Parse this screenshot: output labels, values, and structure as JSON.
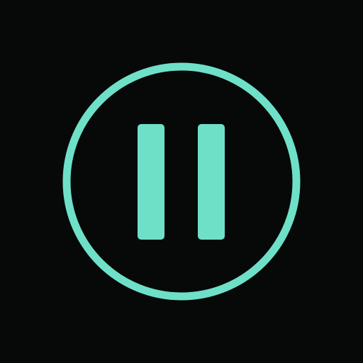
{
  "colors": {
    "background": "#070909",
    "accent": "#6FE0C8"
  },
  "control": {
    "icon": "pause-icon",
    "state": "playing"
  }
}
